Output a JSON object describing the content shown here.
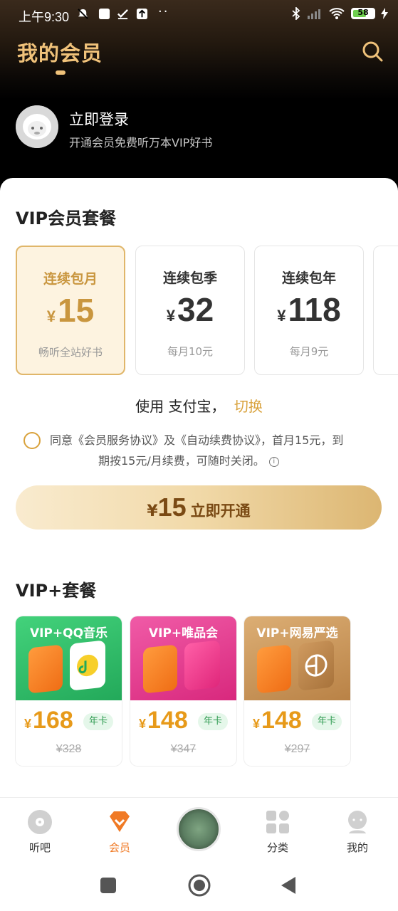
{
  "status_bar": {
    "time": "上午9:30",
    "battery": "58"
  },
  "header": {
    "title": "我的会员"
  },
  "user": {
    "login_label": "立即登录",
    "login_subtitle": "开通会员免费听万本VIP好书"
  },
  "vip": {
    "section_title": "VIP会员套餐",
    "currency": "¥",
    "plans": [
      {
        "name": "连续包月",
        "price": "15",
        "desc": "畅听全站好书",
        "selected": true
      },
      {
        "name": "连续包季",
        "price": "32",
        "desc": "每月10元",
        "selected": false
      },
      {
        "name": "连续包年",
        "price": "118",
        "desc": "每月9元",
        "selected": false
      }
    ],
    "pay_prefix": "使用",
    "pay_method": "支付宝",
    "pay_sep": "，",
    "pay_switch": "切换",
    "agreement_line1": "同意《会员服务协议》及《自动续费协议》，首月15元，到",
    "agreement_line2": "期按15元/月续费，可随时关闭。",
    "open_button": {
      "currency": "¥",
      "amount": "15",
      "label": "立即开通"
    }
  },
  "vip_plus": {
    "section_title": "VIP+套餐",
    "combos": [
      {
        "title": "VIP+QQ音乐",
        "price": "168",
        "tag": "年卡",
        "original": "¥328",
        "color": "#2fbf67"
      },
      {
        "title": "VIP+唯品会",
        "price": "148",
        "tag": "年卡",
        "original": "¥347",
        "color": "#e63a8f"
      },
      {
        "title": "VIP+网易严选",
        "price": "148",
        "tag": "年卡",
        "original": "¥297",
        "color": "#c8955a"
      }
    ]
  },
  "tabbar": {
    "items": [
      {
        "label": "听吧",
        "icon": "disc-icon"
      },
      {
        "label": "会员",
        "icon": "vip-diamond-icon",
        "active": true
      },
      {
        "label": "",
        "icon": "now-playing-cover"
      },
      {
        "label": "分类",
        "icon": "category-grid-icon"
      },
      {
        "label": "我的",
        "icon": "profile-icon"
      }
    ]
  },
  "colors": {
    "accent_gold": "#d9a23c",
    "title_gold": "#f0c27a",
    "active_tab": "#f07a25"
  }
}
